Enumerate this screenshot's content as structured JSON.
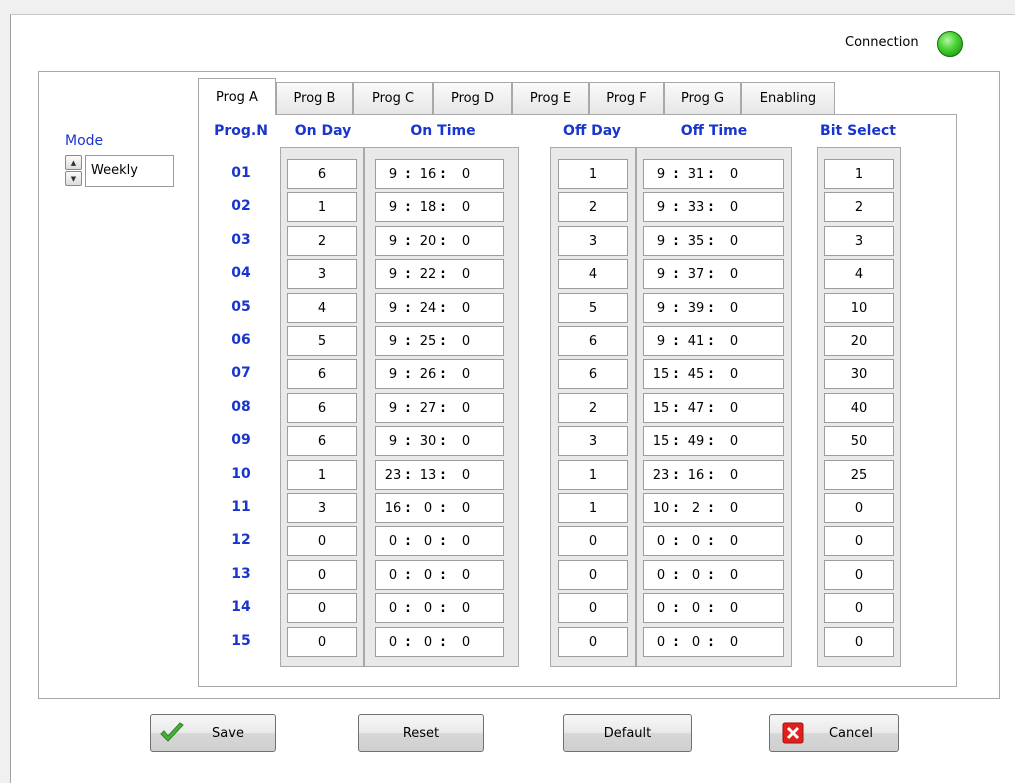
{
  "connection": {
    "label": "Connection",
    "status_color": "#35c21f"
  },
  "mode": {
    "label": "Mode",
    "value": "Weekly"
  },
  "tabs": [
    "Prog A",
    "Prog B",
    "Prog C",
    "Prog D",
    "Prog E",
    "Prog F",
    "Prog G",
    "Enabling"
  ],
  "active_tab": "Prog A",
  "headers": {
    "prog_n": "Prog.N",
    "on_day": "On Day",
    "on_time": "On Time",
    "off_day": "Off Day",
    "off_time": "Off Time",
    "bit_select": "Bit Select"
  },
  "rows": [
    {
      "n": "01",
      "on_day": "6",
      "on_time": [
        "9",
        "16",
        "0"
      ],
      "off_day": "1",
      "off_time": [
        "9",
        "31",
        "0"
      ],
      "bit": "1"
    },
    {
      "n": "02",
      "on_day": "1",
      "on_time": [
        "9",
        "18",
        "0"
      ],
      "off_day": "2",
      "off_time": [
        "9",
        "33",
        "0"
      ],
      "bit": "2"
    },
    {
      "n": "03",
      "on_day": "2",
      "on_time": [
        "9",
        "20",
        "0"
      ],
      "off_day": "3",
      "off_time": [
        "9",
        "35",
        "0"
      ],
      "bit": "3"
    },
    {
      "n": "04",
      "on_day": "3",
      "on_time": [
        "9",
        "22",
        "0"
      ],
      "off_day": "4",
      "off_time": [
        "9",
        "37",
        "0"
      ],
      "bit": "4"
    },
    {
      "n": "05",
      "on_day": "4",
      "on_time": [
        "9",
        "24",
        "0"
      ],
      "off_day": "5",
      "off_time": [
        "9",
        "39",
        "0"
      ],
      "bit": "10"
    },
    {
      "n": "06",
      "on_day": "5",
      "on_time": [
        "9",
        "25",
        "0"
      ],
      "off_day": "6",
      "off_time": [
        "9",
        "41",
        "0"
      ],
      "bit": "20"
    },
    {
      "n": "07",
      "on_day": "6",
      "on_time": [
        "9",
        "26",
        "0"
      ],
      "off_day": "6",
      "off_time": [
        "15",
        "45",
        "0"
      ],
      "bit": "30"
    },
    {
      "n": "08",
      "on_day": "6",
      "on_time": [
        "9",
        "27",
        "0"
      ],
      "off_day": "2",
      "off_time": [
        "15",
        "47",
        "0"
      ],
      "bit": "40"
    },
    {
      "n": "09",
      "on_day": "6",
      "on_time": [
        "9",
        "30",
        "0"
      ],
      "off_day": "3",
      "off_time": [
        "15",
        "49",
        "0"
      ],
      "bit": "50"
    },
    {
      "n": "10",
      "on_day": "1",
      "on_time": [
        "23",
        "13",
        "0"
      ],
      "off_day": "1",
      "off_time": [
        "23",
        "16",
        "0"
      ],
      "bit": "25"
    },
    {
      "n": "11",
      "on_day": "3",
      "on_time": [
        "16",
        "0",
        "0"
      ],
      "off_day": "1",
      "off_time": [
        "10",
        "2",
        "0"
      ],
      "bit": "0"
    },
    {
      "n": "12",
      "on_day": "0",
      "on_time": [
        "0",
        "0",
        "0"
      ],
      "off_day": "0",
      "off_time": [
        "0",
        "0",
        "0"
      ],
      "bit": "0"
    },
    {
      "n": "13",
      "on_day": "0",
      "on_time": [
        "0",
        "0",
        "0"
      ],
      "off_day": "0",
      "off_time": [
        "0",
        "0",
        "0"
      ],
      "bit": "0"
    },
    {
      "n": "14",
      "on_day": "0",
      "on_time": [
        "0",
        "0",
        "0"
      ],
      "off_day": "0",
      "off_time": [
        "0",
        "0",
        "0"
      ],
      "bit": "0"
    },
    {
      "n": "15",
      "on_day": "0",
      "on_time": [
        "0",
        "0",
        "0"
      ],
      "off_day": "0",
      "off_time": [
        "0",
        "0",
        "0"
      ],
      "bit": "0"
    }
  ],
  "time_separator": ":",
  "buttons": {
    "save": {
      "label": "Save",
      "icon": "checkmark-icon"
    },
    "reset": {
      "label": "Reset"
    },
    "default": {
      "label": "Default"
    },
    "cancel": {
      "label": "Cancel",
      "icon": "red-x-icon"
    }
  },
  "colors": {
    "accent_blue": "#1a35cc",
    "cancel_red": "#e0211b",
    "check_green": "#46b23a"
  }
}
